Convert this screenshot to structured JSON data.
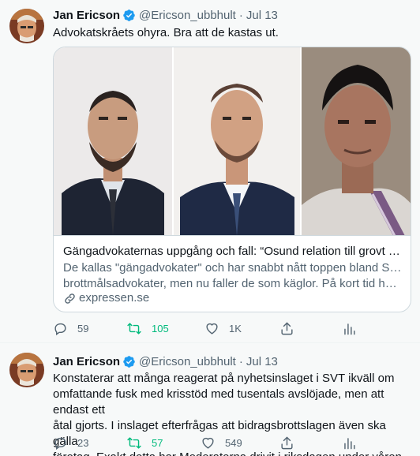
{
  "tweets": [
    {
      "author": {
        "name": "Jan Ericson",
        "handle": "@Ericson_ubbhult",
        "date": "Jul 13"
      },
      "text": "Advokatskråets ohyra. Bra att de kastas ut.",
      "card": {
        "title": "Gängadvokaternas uppgång och fall: “Osund relation till grovt kriminel…",
        "desc_line1": "De kallas \"gängadvokater\" och har snabbt nått toppen bland Sveriges",
        "desc_line2": "brottmålsadvokater, men nu faller de som käglor. På kort tid har fyra …",
        "domain": "expressen.se"
      },
      "stats": {
        "replies": "59",
        "retweets": "105",
        "likes": "1K"
      }
    },
    {
      "author": {
        "name": "Jan Ericson",
        "handle": "@Ericson_ubbhult",
        "date": "Jul 13"
      },
      "text_lines": [
        "Konstaterar att många reagerat på nyhetsinslaget i SVT ikväll om",
        "omfattande fusk med krisstöd med tusentals avslöjade, men att endast ett",
        "åtal gjorts. I inslaget efterfrågas att bidragsbrottslagen även ska gälla",
        "företag. Exakt detta har Moderaterna drivit i riksdagen under våren."
      ],
      "stats": {
        "replies": "23",
        "retweets": "57",
        "likes": "549"
      }
    }
  ],
  "icons": {
    "verified": "verified-badge-icon",
    "reply": "reply-icon",
    "retweet": "retweet-icon",
    "like": "heart-icon",
    "share": "share-icon",
    "analytics": "analytics-icon",
    "link": "link-icon"
  },
  "colors": {
    "verified": "#1d9bf0",
    "retweet_active": "#00ba7c",
    "muted_text": "#536471",
    "background": "#f7f9f9"
  }
}
